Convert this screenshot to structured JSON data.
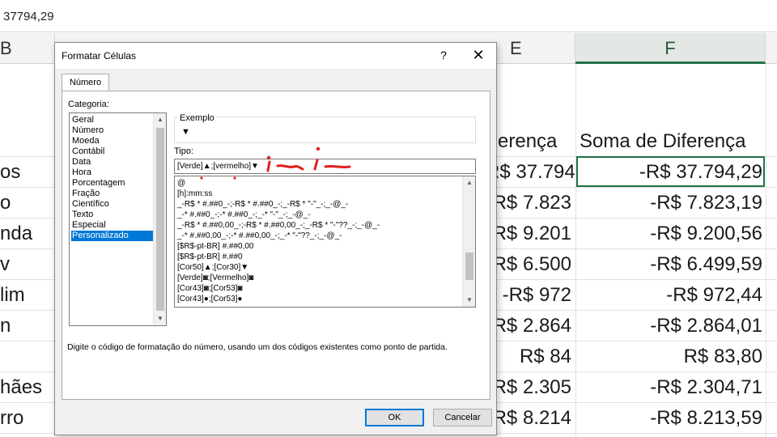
{
  "formula_bar": {
    "value": "37794,29"
  },
  "columns": [
    {
      "label": "B"
    },
    {
      "label": "E"
    },
    {
      "label": "F"
    }
  ],
  "sheet": {
    "col_b_cells": [
      "os",
      "o",
      "nda",
      "v",
      "lim",
      "n",
      "",
      "hães",
      "rro"
    ],
    "col_e_header": "erença",
    "col_e_values": [
      "R$ 37.794",
      "R$ 7.823",
      "R$ 9.201",
      "R$ 6.500",
      "-R$ 972",
      "R$ 2.864",
      "R$ 84",
      "R$ 2.305",
      "R$ 8.214"
    ],
    "col_f_header": "Soma de Diferença",
    "col_f_values": [
      "-R$ 37.794,29",
      "-R$ 7.823,19",
      "-R$ 9.200,56",
      "-R$ 6.499,59",
      "-R$ 972,44",
      "-R$ 2.864,01",
      "R$ 83,80",
      "-R$ 2.304,71",
      "-R$ 8.213,59"
    ]
  },
  "dialog": {
    "title": "Formatar Células",
    "help": "?",
    "close": "✕",
    "tab": "Número",
    "category_label": "Categoria:",
    "categories": [
      "Geral",
      "Número",
      "Moeda",
      "Contábil",
      "Data",
      "Hora",
      "Porcentagem",
      "Fração",
      "Científico",
      "Texto",
      "Especial",
      "Personalizado"
    ],
    "selected_category": "Personalizado",
    "example_label": "Exemplo",
    "example_value": "▼",
    "type_label": "Tipo:",
    "type_value": "[Verde]▲;[vermelho]▼",
    "type_list": [
      "@",
      "[h]:mm:ss",
      "_-R$ * #.##0_-;-R$ * #.##0_-;_-R$ * \"-\"_-;_-@_-",
      "_-* #.##0_-;-* #.##0_-;_-* \"-\"_-;_-@_-",
      "_-R$ * #.##0,00_-;-R$ * #.##0,00_-;_-R$ * \"-\"??_-;_-@_-",
      "_-* #.##0,00_-;-* #.##0,00_-;_-* \"-\"??_-;_-@_-",
      "[$R$-pt-BR] #.##0,00",
      "[$R$-pt-BR] #.##0",
      "[Cor50]▲;[Cor30]▼",
      "[Verde]◙;[Vermelho]◙",
      "[Cor43]◙;[Cor53]◙",
      "[Cor43]●;[Cor53]●"
    ],
    "description": "Digite o código de formatação do número, usando um dos códigos existentes como ponto de partida.",
    "ok_label": "OK",
    "cancel_label": "Cancelar"
  },
  "colors": {
    "selection": "#0078d7",
    "excel_green": "#217346",
    "annotation_red": "#e0201b"
  }
}
